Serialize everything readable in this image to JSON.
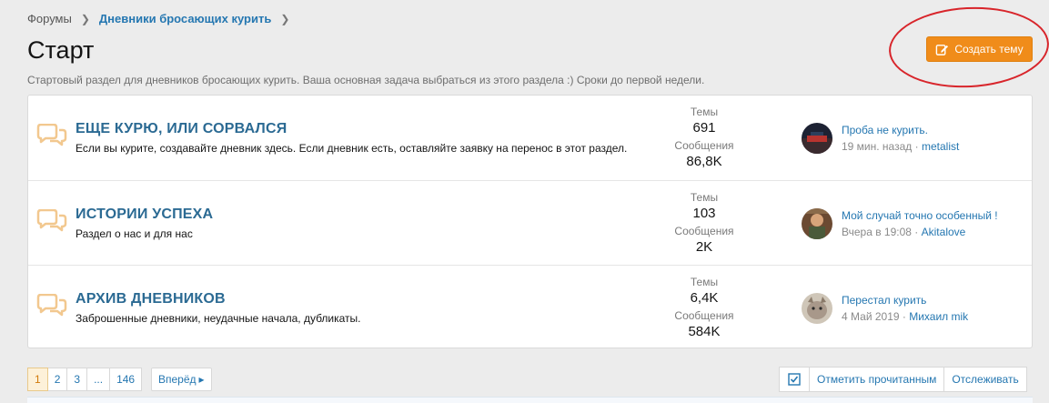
{
  "breadcrumb": {
    "home": "Форумы",
    "current": "Дневники бросающих курить"
  },
  "page": {
    "title": "Старт",
    "description": "Стартовый раздел для дневников бросающих курить. Ваша основная задача выбраться из этого раздела :) Сроки до первой недели."
  },
  "create_button": {
    "label": "Создать тему"
  },
  "nodes": [
    {
      "title": "ЕЩЕ КУРЮ, ИЛИ СОРВАЛСЯ",
      "description": "Если вы курите, создавайте дневник здесь. Если дневник есть, оставляйте заявку на перенос в этот раздел.",
      "threads_label": "Темы",
      "threads": "691",
      "messages_label": "Сообщения",
      "messages": "86,8K",
      "last_thread": "Проба не курить.",
      "last_time": "19 мин. назад",
      "last_user": "metalist"
    },
    {
      "title": "ИСТОРИИ УСПЕХА",
      "description": "Раздел о нас и для нас",
      "threads_label": "Темы",
      "threads": "103",
      "messages_label": "Сообщения",
      "messages": "2K",
      "last_thread": "Мой случай точно особенный !",
      "last_time": "Вчера в 19:08",
      "last_user": "Akitalove"
    },
    {
      "title": "АРХИВ ДНЕВНИКОВ",
      "description": "Заброшенные дневники, неудачные начала, дубликаты.",
      "threads_label": "Темы",
      "threads": "6,4K",
      "messages_label": "Сообщения",
      "messages": "584K",
      "last_thread": "Перестал курить",
      "last_time": "4 Май 2019",
      "last_user": "Михаил mik"
    }
  ],
  "meta_separator": "·",
  "pagination": {
    "pages": [
      "1",
      "2",
      "3",
      "...",
      "146"
    ],
    "current": "1",
    "next_label": "Вперёд",
    "next_arrow": "▸"
  },
  "actions": {
    "mark_read": "Отметить прочитанным",
    "watch": "Отслеживать"
  },
  "colors": {
    "accent": "#f08c1a",
    "link": "#2577b1",
    "node_title": "#2b6a93",
    "annotation_circle": "#d8252b"
  }
}
